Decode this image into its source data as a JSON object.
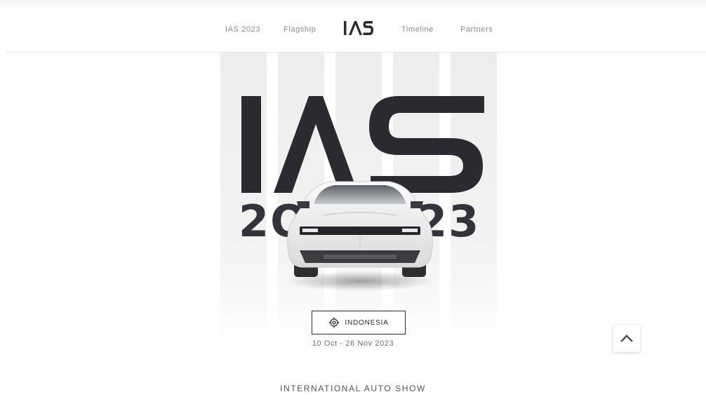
{
  "nav": {
    "links": [
      {
        "label": "IAS 2023"
      },
      {
        "label": "Flagship"
      },
      {
        "label": "Timeline"
      },
      {
        "label": "Partners"
      }
    ],
    "logo_text": "IAS"
  },
  "hero": {
    "logo_top": "IAS",
    "logo_bottom": "2023",
    "location_icon": "crosshair-icon",
    "location_label": "INDONESIA",
    "dates": "10 Oct - 26 Nov 2023",
    "tagline": "INTERNATIONAL AUTO SHOW"
  },
  "scroll_top_icon": "chevron-up-icon",
  "colors": {
    "text_dark": "#2b2a30",
    "nav_text": "#8a8a8e",
    "stripe": "#ededed",
    "background": "#ffffff"
  }
}
